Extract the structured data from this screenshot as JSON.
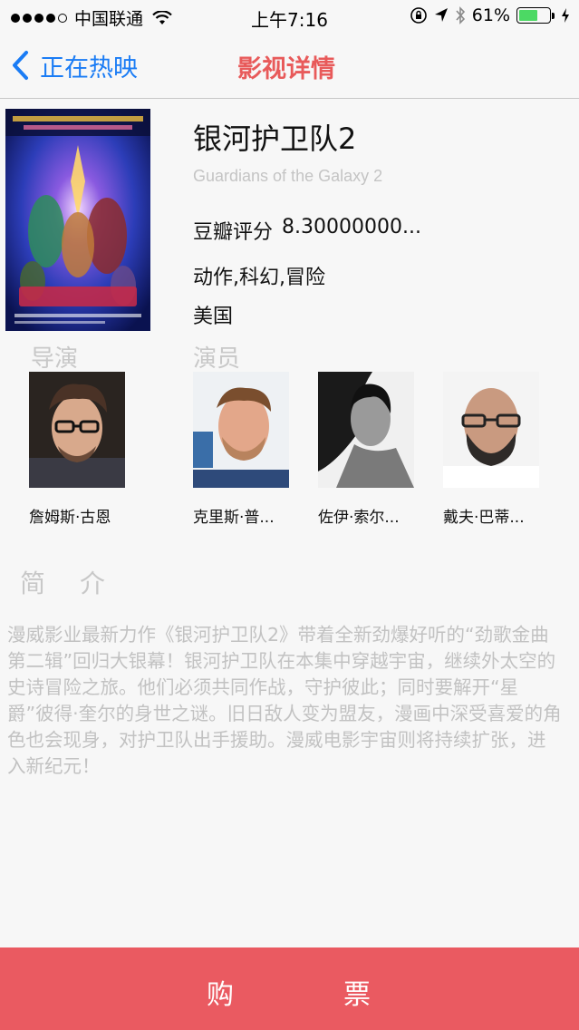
{
  "status_bar": {
    "carrier": "中国联通",
    "time": "上午7:16",
    "battery": "61%",
    "battery_level": 0.61,
    "icons": [
      "signal-dots-icon",
      "wifi-icon",
      "orientation-lock-icon",
      "location-arrow-icon",
      "bluetooth-icon",
      "battery-icon",
      "charging-icon"
    ]
  },
  "nav": {
    "back_label": "正在热映",
    "title": "影视详情"
  },
  "movie": {
    "title": "银河护卫队2",
    "subtitle": "Guardians of the Galaxy 2",
    "rating_label": "豆瓣评分",
    "rating_value": "8.30000000...",
    "genres": "动作,科幻,冒险",
    "country": "美国"
  },
  "sections": {
    "director": "导演",
    "actors": "演员",
    "intro": "简介"
  },
  "director": {
    "name": "詹姆斯·古恩"
  },
  "actors": [
    {
      "name": "克里斯·普..."
    },
    {
      "name": "佐伊·索尔..."
    },
    {
      "name": "戴夫·巴蒂..."
    }
  ],
  "intro_text": "漫威影业最新力作《银河护卫队2》带着全新劲爆好听的“劲歌金曲第二辑”回归大银幕！银河护卫队在本集中穿越宇宙，继续外太空的史诗冒险之旅。他们必须共同作战，守护彼此；同时要解开“星爵”彼得·奎尔的身世之谜。旧日敌人变为盟友，漫画中深受喜爱的角色也会现身，对护卫队出手援助。漫威电影宇宙则将持续扩张，进入新纪元！",
  "buy": {
    "char1": "购",
    "char2": "票"
  },
  "colors": {
    "accent_blue": "#1a7cf5",
    "title_red": "#e85a5a",
    "buy_bar": "#ea5a61",
    "muted_text": "#c2c2c2",
    "battery_green": "#4cd964"
  }
}
